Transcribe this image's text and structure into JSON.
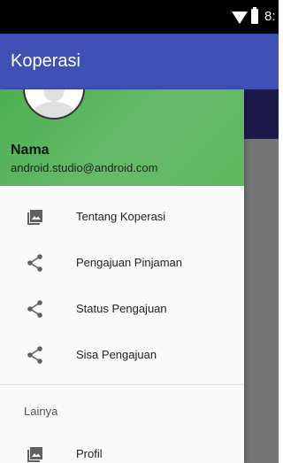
{
  "status_bar": {
    "time": "8:"
  },
  "app_bar": {
    "title": "Koperasi"
  },
  "drawer": {
    "header": {
      "name": "Nama",
      "email": "android.studio@android.com"
    },
    "items": [
      {
        "label": "Tentang Koperasi",
        "icon": "gallery-icon"
      },
      {
        "label": "Pengajuan Pinjaman",
        "icon": "share-icon"
      },
      {
        "label": "Status Pengajuan",
        "icon": "share-icon"
      },
      {
        "label": "Sisa Pengajuan",
        "icon": "share-icon"
      }
    ],
    "section": {
      "title": "Lainya",
      "items": [
        {
          "label": "Profil",
          "icon": "gallery-icon"
        }
      ]
    }
  },
  "colors": {
    "app_bar": "#3f51b5",
    "drawer_header": "#4caf50",
    "status_bar": "#000000",
    "scrim": "#757575"
  }
}
